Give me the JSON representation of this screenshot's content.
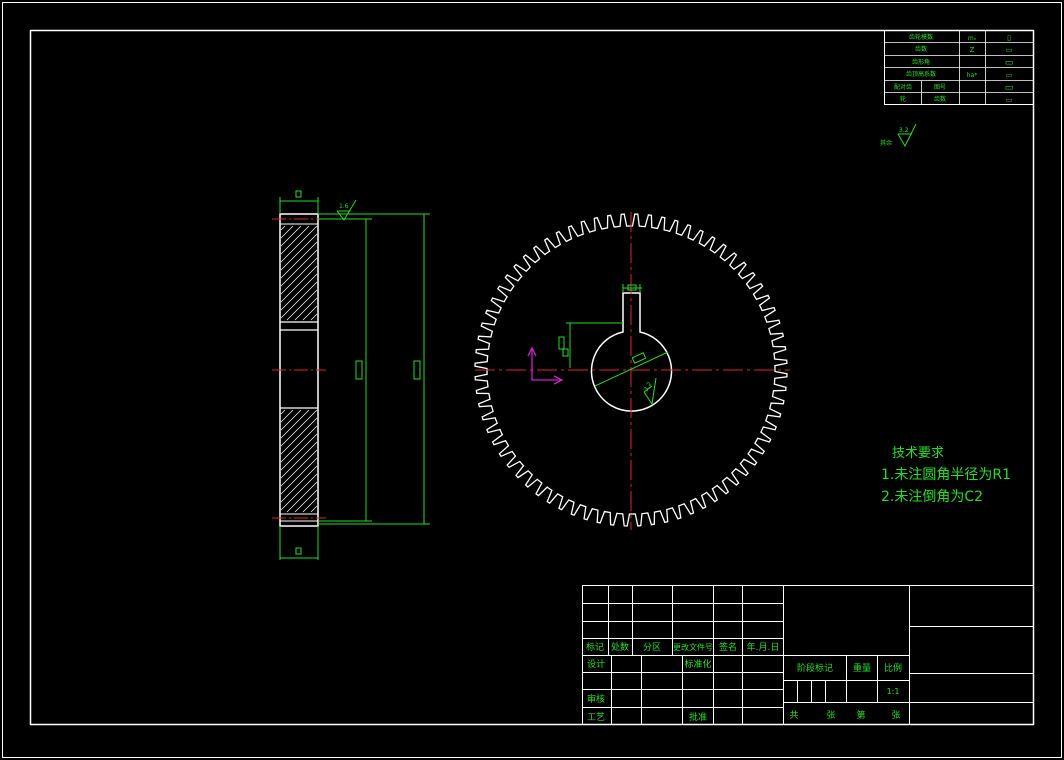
{
  "colors": {
    "background": "#000000",
    "border": "#ffffff",
    "dimension": "#21e021",
    "centerline": "#e0222a",
    "ucs": "#d020d0",
    "gear_outline": "#ffffff",
    "text_white": "#ffffff",
    "text_green": "#21e021"
  },
  "gear": {
    "teeth": 72
  },
  "gear_params_table": {
    "rows": [
      {
        "label": "齿轮模数",
        "symbol": "mₙ",
        "value": "▯"
      },
      {
        "label": "齿数",
        "symbol": "Z",
        "value": "▭"
      },
      {
        "label": "齿形角",
        "symbol": "",
        "value": "▭"
      },
      {
        "label": "齿顶高系数",
        "symbol": "ha*",
        "value": "▭"
      },
      {
        "label": "配对齿",
        "label2": "图号",
        "symbol": "",
        "value": "▭"
      },
      {
        "label": "轮",
        "label2": "齿数",
        "symbol": "",
        "value": "▭"
      }
    ]
  },
  "roughness": {
    "corner_label": "其余",
    "corner_value": "3.2",
    "side_value": "1.6",
    "bore_value": "3.2"
  },
  "tech_requirements": {
    "title": "技术要求",
    "items": [
      "1.未注圆角半径为R1",
      "2.未注倒角为C2"
    ]
  },
  "title_block": {
    "headers": [
      "标记",
      "处数",
      "分区",
      "更改文件号",
      "签名",
      "年.月.日"
    ],
    "row_labels": {
      "design": "设计",
      "standardize": "标准化",
      "review": "审核",
      "process": "工艺",
      "approve": "批准"
    },
    "stage_label": "阶段标记",
    "weight_label": "重量",
    "scale_label": "比例",
    "scale_value": "1:1",
    "sheet_text": [
      "共",
      "张",
      "第",
      "张"
    ]
  },
  "dimension_placeholder": "▯"
}
